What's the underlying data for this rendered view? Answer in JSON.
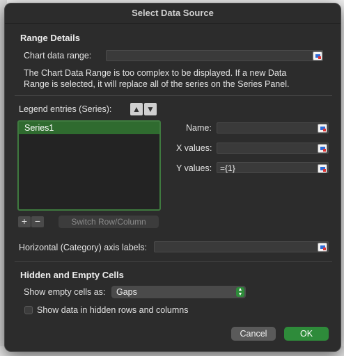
{
  "dialog": {
    "title": "Select Data Source",
    "range_details": {
      "heading": "Range Details",
      "chart_data_range_label": "Chart data range:",
      "chart_data_range_value": "",
      "info_line1": "The Chart Data Range is too complex to be displayed. If a new Data",
      "info_line2": "Range is selected, it will replace all of the series on the Series Panel."
    },
    "legend": {
      "label": "Legend entries (Series):",
      "items": [
        "Series1"
      ],
      "add_label": "+",
      "remove_label": "−",
      "switch_label": "Switch Row/Column"
    },
    "series_fields": {
      "name_label": "Name:",
      "name_value": "",
      "x_label": "X values:",
      "x_value": "",
      "y_label": "Y values:",
      "y_value": "={1}"
    },
    "axis": {
      "label": "Horizontal (Category) axis labels:",
      "value": ""
    },
    "hidden_empty": {
      "heading": "Hidden and Empty Cells",
      "show_empty_label": "Show empty cells as:",
      "show_empty_value": "Gaps",
      "show_hidden_label": "Show data in hidden rows and columns",
      "show_hidden_checked": false
    },
    "buttons": {
      "cancel": "Cancel",
      "ok": "OK"
    }
  },
  "colors": {
    "accent_green": "#2e8b3a",
    "selection_green": "#2f6b2f",
    "dialog_bg": "#2c2c2c"
  }
}
